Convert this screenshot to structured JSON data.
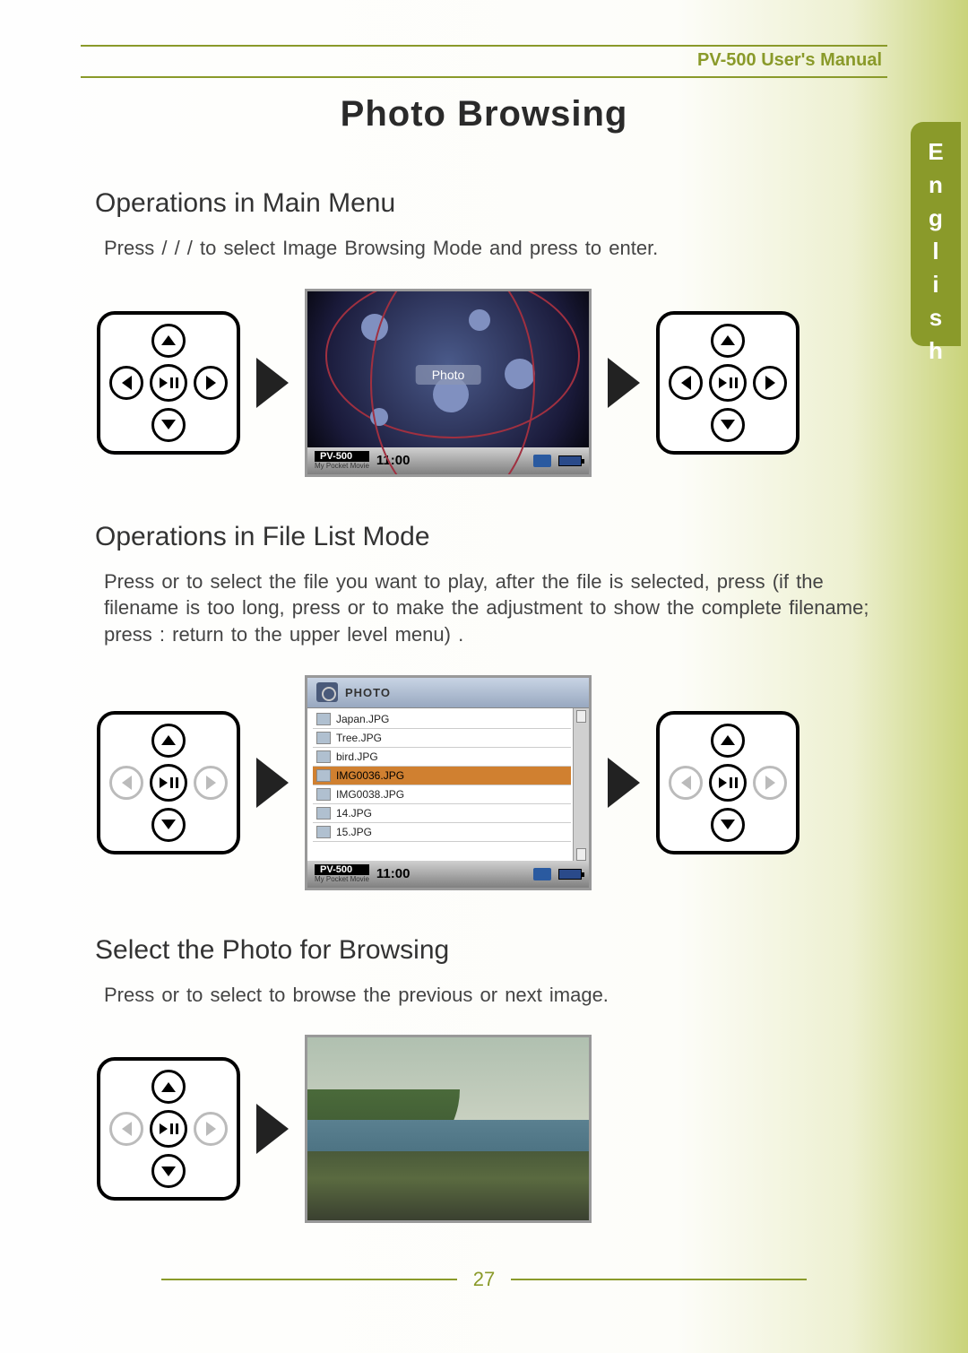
{
  "header": {
    "manual": "PV-500 User's Manual"
  },
  "title": "Photo Browsing",
  "language_tab": "English",
  "page_number": "27",
  "sections": {
    "s1": {
      "heading": "Operations in Main Menu",
      "text": "Press    /   /   /    to select Image Browsing Mode and press      to enter."
    },
    "s2": {
      "heading": "Operations in File List Mode",
      "text": "Press    or    to select the file you want to play, after the file is selected, press     (if the filename is too long, press    or    to make the adjustment to show the complete filename; press    : return to the upper level menu) ."
    },
    "s3": {
      "heading": "Select the Photo for Browsing",
      "text": "Press    or    to select to browse the previous or next image."
    }
  },
  "main_screen": {
    "label": "Photo",
    "model": "PV-500",
    "subtitle": "My Pocket Movie",
    "time": "11:00"
  },
  "file_list": {
    "header": "PHOTO",
    "files": [
      "Japan.JPG",
      "Tree.JPG",
      "bird.JPG",
      "IMG0036.JPG",
      "IMG0038.JPG",
      "14.JPG",
      "15.JPG"
    ],
    "selected_index": 3,
    "model": "PV-500",
    "subtitle": "My Pocket Movie",
    "time": "11:00"
  }
}
